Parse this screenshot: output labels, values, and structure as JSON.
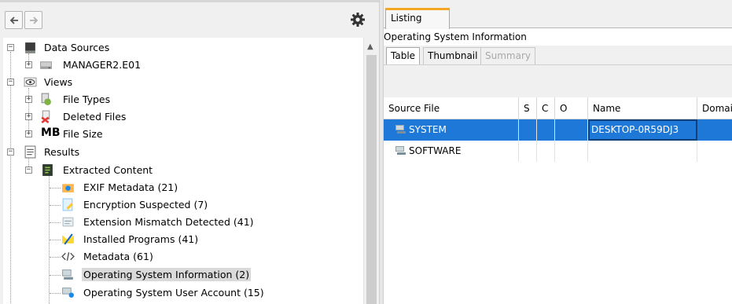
{
  "nav": {
    "back": "back",
    "forward": "forward",
    "settings": "settings"
  },
  "tree": [
    {
      "label": "Data Sources",
      "icon": "disk-icon"
    },
    {
      "label": "MANAGER2.E01",
      "icon": "drive-icon"
    },
    {
      "label": "Views",
      "icon": "eye-icon"
    },
    {
      "label": "File Types",
      "icon": "filetypes-icon"
    },
    {
      "label": "Deleted Files",
      "icon": "deleted-icon"
    },
    {
      "prefix": "MB",
      "label": "File Size",
      "icon": "mb-icon"
    },
    {
      "label": "Results",
      "icon": "results-icon"
    },
    {
      "label": "Extracted Content",
      "icon": "extracted-icon"
    },
    {
      "label": "EXIF Metadata (21)",
      "icon": "camera-icon"
    },
    {
      "label": "Encryption Suspected (7)",
      "icon": "lock-doc-icon"
    },
    {
      "label": "Extension Mismatch Detected (41)",
      "icon": "mismatch-icon"
    },
    {
      "label": "Installed Programs (41)",
      "icon": "programs-icon"
    },
    {
      "label": "Metadata (61)",
      "icon": "code-icon"
    },
    {
      "label": "Operating System Information (2)",
      "icon": "computer-icon"
    },
    {
      "label": "Operating System User Account (15)",
      "icon": "user-computer-icon"
    }
  ],
  "right": {
    "tab": "Listing",
    "section_title": "Operating System Information",
    "subtabs": [
      "Table",
      "Thumbnail",
      "Summary"
    ],
    "columns": [
      "Source File",
      "S",
      "C",
      "O",
      "Name",
      "Domain"
    ],
    "rows": [
      {
        "source": "SYSTEM",
        "s": "",
        "c": "",
        "o": "",
        "name": "DESKTOP-0R59DJ3",
        "domain": ""
      },
      {
        "source": "SOFTWARE",
        "s": "",
        "c": "",
        "o": "",
        "name": "",
        "domain": ""
      }
    ]
  },
  "colors": {
    "selection": "#1e78d7",
    "tab_accent": "#f5a623"
  }
}
